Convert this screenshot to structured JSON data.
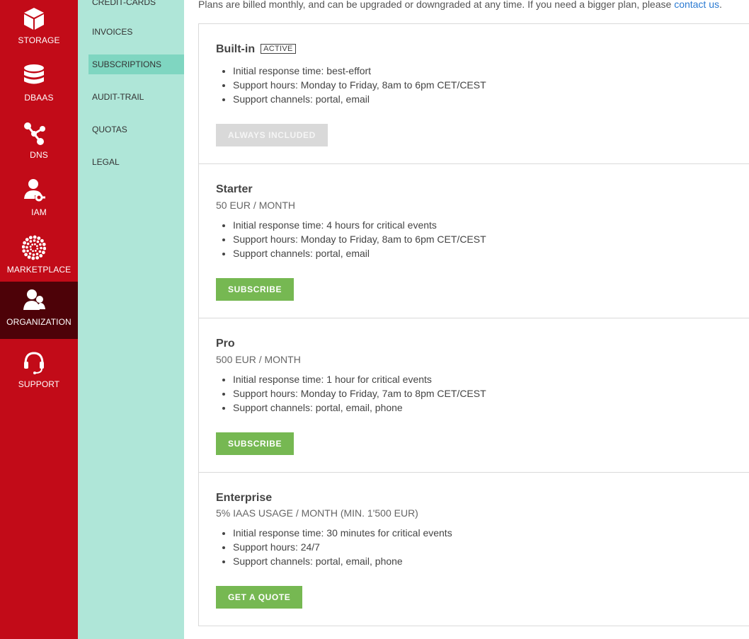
{
  "rail": {
    "items": [
      {
        "label": "STORAGE",
        "icon": "cube-icon"
      },
      {
        "label": "DBAAS",
        "icon": "database-icon"
      },
      {
        "label": "DNS",
        "icon": "network-nodes-icon"
      },
      {
        "label": "IAM",
        "icon": "user-key-icon"
      },
      {
        "label": "MARKETPLACE",
        "icon": "marketplace-dots-icon"
      },
      {
        "label": "ORGANIZATION",
        "icon": "organization-users-icon"
      },
      {
        "label": "SUPPORT",
        "icon": "headset-icon"
      }
    ],
    "active": "ORGANIZATION"
  },
  "subnav": {
    "items": [
      "CREDIT-CARDS",
      "INVOICES",
      "SUBSCRIPTIONS",
      "AUDIT-TRAIL",
      "QUOTAS",
      "LEGAL"
    ],
    "active": "SUBSCRIPTIONS"
  },
  "intro": {
    "text": "Plans are billed monthly, and can be upgraded or downgraded at any time. If you need a bigger plan, please ",
    "link": "contact us",
    "tail": "."
  },
  "plans": [
    {
      "name": "Built-in",
      "badge": "ACTIVE",
      "features": [
        "Initial response time: best-effort",
        "Support hours: Monday to Friday, 8am to 6pm CET/CEST",
        "Support channels: portal, email"
      ],
      "button": "ALWAYS INCLUDED"
    },
    {
      "name": "Starter",
      "price": "50 EUR / MONTH",
      "features": [
        "Initial response time: 4 hours for critical events",
        "Support hours: Monday to Friday, 8am to 6pm CET/CEST",
        "Support channels: portal, email"
      ],
      "button": "SUBSCRIBE"
    },
    {
      "name": "Pro",
      "price": "500 EUR / MONTH",
      "features": [
        "Initial response time: 1 hour for critical events",
        "Support hours: Monday to Friday, 7am to 8pm CET/CEST",
        "Support channels: portal, email, phone"
      ],
      "button": "SUBSCRIBE"
    },
    {
      "name": "Enterprise",
      "price": "5% IAAS USAGE / MONTH (MIN. 1'500 EUR)",
      "features": [
        "Initial response time: 30 minutes for critical events",
        "Support hours: 24/7",
        "Support channels: portal, email, phone"
      ],
      "button": "GET A QUOTE"
    }
  ],
  "colors": {
    "rail": "#c20b18",
    "rail_active": "#4d0208",
    "subnav": "#afe6d8",
    "subnav_active": "#7fd6c1",
    "button": "#76b852",
    "button_disabled": "#d9d9d9",
    "link": "#2a7ad2"
  }
}
